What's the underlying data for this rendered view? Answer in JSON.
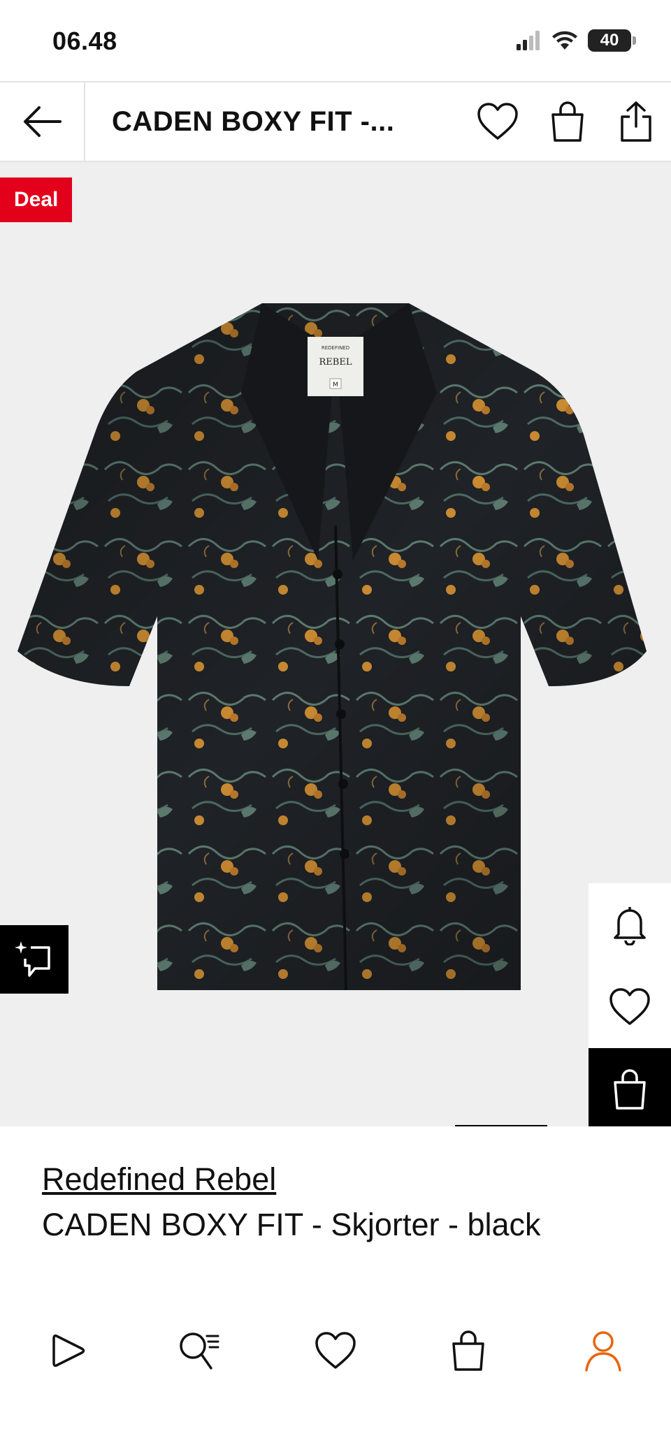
{
  "status_bar": {
    "time": "06.48",
    "battery": "40"
  },
  "header": {
    "title": "CADEN BOXY FIT -..."
  },
  "gallery": {
    "deal_badge": "Deal"
  },
  "product": {
    "brand": "Redefined Rebel",
    "name": "CADEN BOXY FIT - Skjorter - black",
    "label_brand": "REBEL",
    "label_top": "REDEFINED",
    "label_size": "M"
  },
  "colors": {
    "accent": "#e3001b",
    "profile": "#e8650f",
    "gallery_bg": "#efefef"
  },
  "icons": {
    "header": [
      "back-arrow-icon",
      "heart-icon",
      "bag-icon",
      "share-icon"
    ],
    "side": [
      "bell-icon",
      "heart-icon",
      "bag-icon"
    ],
    "nav": [
      "play-icon",
      "search-list-icon",
      "heart-icon",
      "bag-icon",
      "profile-icon"
    ]
  }
}
